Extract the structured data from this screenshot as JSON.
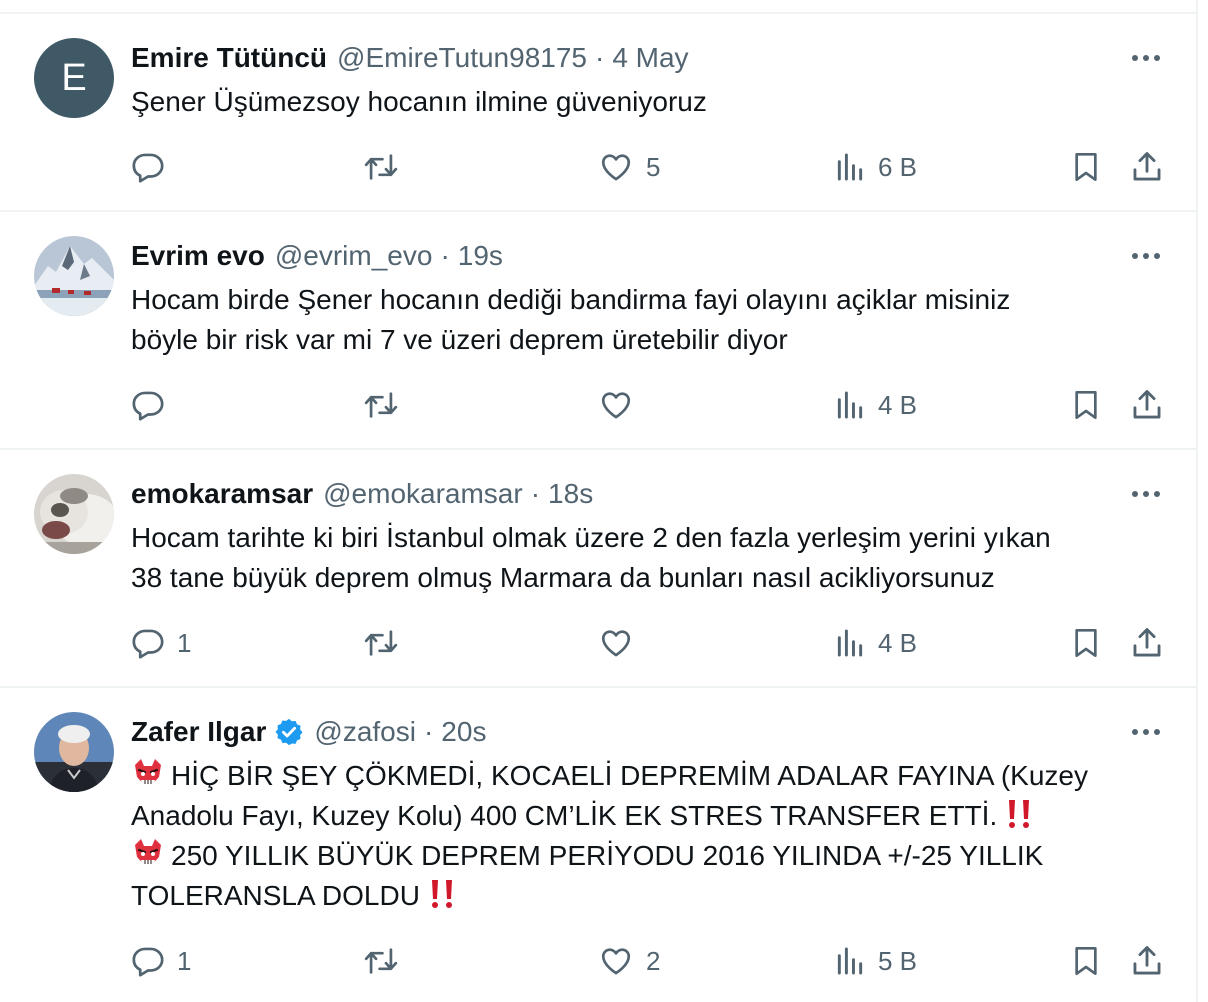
{
  "tweets": [
    {
      "name": "Emire Tütüncü",
      "handle": "@EmireTutun98175",
      "time": "4 May",
      "avatar_letter": "E",
      "verified": false,
      "lines": [
        "Şener Üşümezsoy hocanın ilmine güveniyoruz"
      ],
      "replies": "",
      "likes": "5",
      "views": "6 B"
    },
    {
      "name": "Evrim evo",
      "handle": "@evrim_evo",
      "time": "19s",
      "verified": false,
      "lines": [
        "Hocam birde Şener hocanın dediği bandirma fayi olayını açiklar misiniz",
        "böyle bir risk var mi 7 ve üzeri deprem üretebilir diyor"
      ],
      "replies": "",
      "likes": "",
      "views": "4 B"
    },
    {
      "name": "emokaramsar",
      "handle": "@emokaramsar",
      "time": "18s",
      "verified": false,
      "lines": [
        "Hocam tarihte ki biri İstanbul olmak üzere 2 den fazla yerleşim yerini yıkan",
        "38 tane büyük deprem olmuş Marmara da bunları nasıl acikliyorsunuz"
      ],
      "replies": "1",
      "likes": "",
      "views": "4 B"
    },
    {
      "name": "Zafer Ilgar",
      "handle": "@zafosi",
      "time": "20s",
      "verified": true,
      "lines": [
        "HİÇ BİR ŞEY  ÇÖKMEDİ, KOCAELİ DEPREMİM ADALAR FAYINA (Kuzey",
        "Anadolu Fayı, Kuzey Kolu) 400 CM’LİK EK STRES TRANSFER ETTİ.",
        "250 YILLIK BÜYÜK DEPREM PERİYODU 2016 YILINDA +/-25 YILLIK",
        "TOLERANSLA DOLDU "
      ],
      "replies": "1",
      "likes": "2",
      "views": "5 B"
    }
  ],
  "colors": {
    "text": "#0f1419",
    "secondary": "#536471",
    "divider": "#eff3f4",
    "verified": "#1d9bf0",
    "avatar_default": "#3f5a66",
    "emoji_red": "#e0313e"
  },
  "icons": [
    "reply-icon",
    "retweet-icon",
    "like-icon",
    "views-icon",
    "bookmark-icon",
    "share-icon",
    "more-icon",
    "verified-icon",
    "goblin-emoji",
    "double-exclamation-emoji"
  ]
}
